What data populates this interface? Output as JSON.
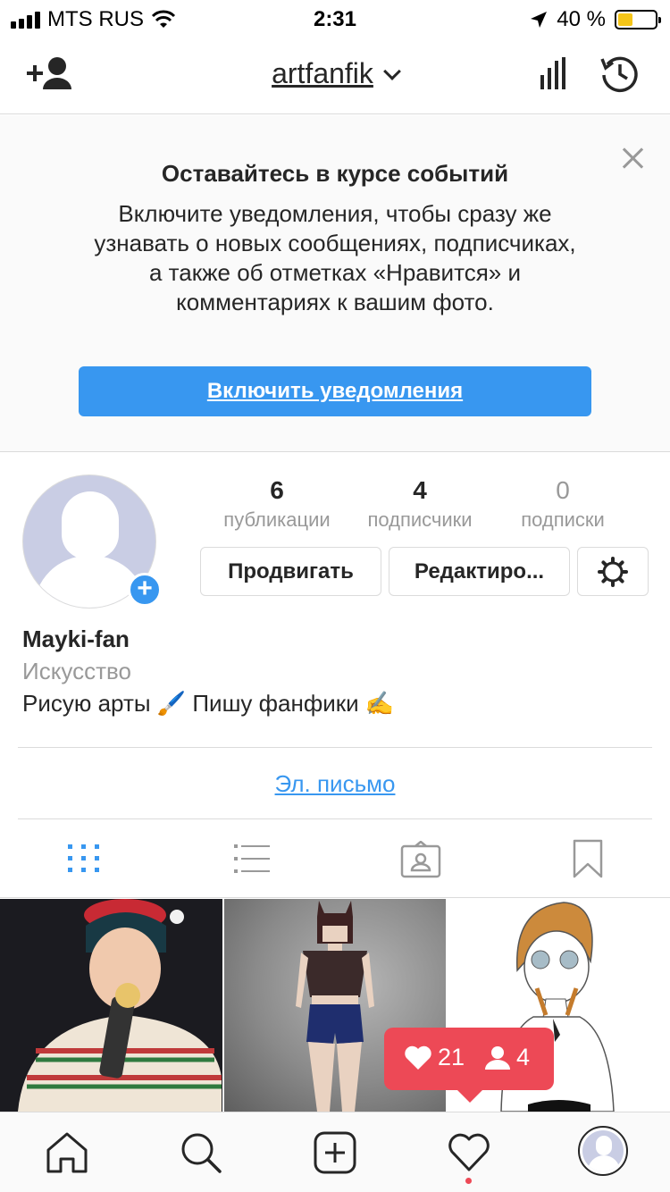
{
  "status_bar": {
    "carrier": "MTS RUS",
    "time": "2:31",
    "battery_percent": "40 %",
    "battery_level": 0.4
  },
  "header": {
    "username": "artfanfik",
    "icons": [
      "add-user-icon",
      "chevron-down-icon",
      "insights-icon",
      "archive-icon"
    ]
  },
  "notification": {
    "title": "Оставайтесь в курсе событий",
    "body": "Включите уведомления, чтобы сразу же узнавать о новых сообщениях, подписчиках, а также об отметках «Нравится» и комментариях к вашим фото.",
    "button_label": "Включить уведомления"
  },
  "profile": {
    "stats": [
      {
        "value": "6",
        "label": "публикации"
      },
      {
        "value": "4",
        "label": "подписчики"
      },
      {
        "value": "0",
        "label": "подписки"
      }
    ],
    "promote_label": "Продвигать",
    "edit_label": "Редактиро...",
    "name": "Mayki-fan",
    "category": "Искусство",
    "bio": "Рисую арты 🖌️ Пишу фанфики ✍️",
    "email_label": "Эл. письмо"
  },
  "tabs": [
    "grid-icon",
    "list-icon",
    "tagged-icon",
    "saved-icon"
  ],
  "activity": {
    "likes": "21",
    "followers": "4"
  },
  "bottom_nav": [
    "home-icon",
    "search-icon",
    "new-post-icon",
    "activity-heart-icon",
    "profile-avatar-icon"
  ],
  "colors": {
    "accent": "#3897f0",
    "activity": "#ed4956",
    "muted": "#999999",
    "border": "#dbdbdb"
  }
}
